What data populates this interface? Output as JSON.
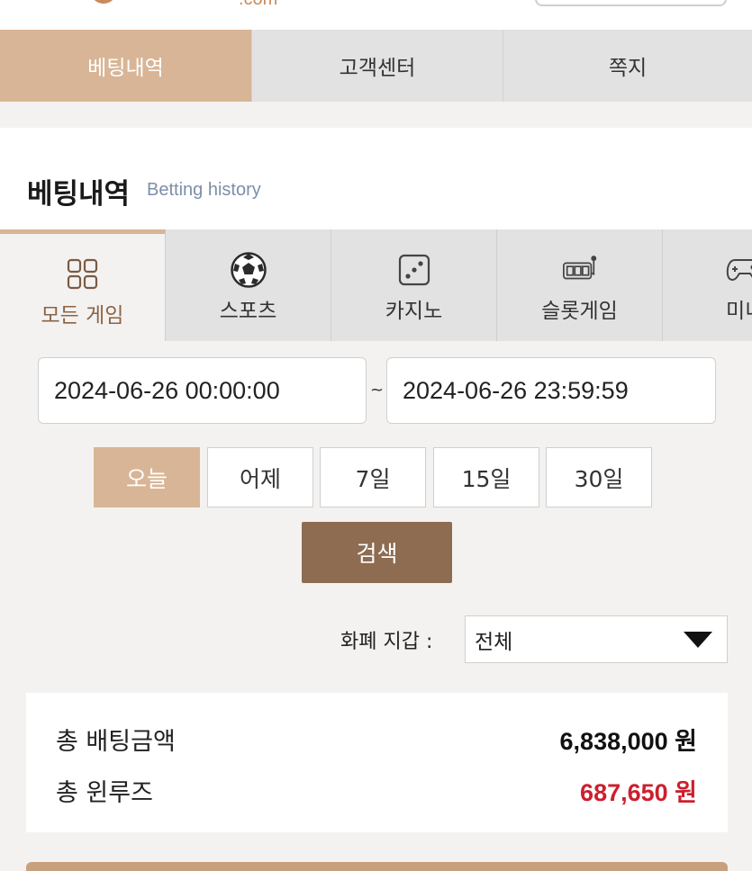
{
  "header": {
    "logo_suffix": ".com"
  },
  "main_nav": [
    "베팅내역",
    "고객센터",
    "쪽지"
  ],
  "page": {
    "title_ko": "베팅내역",
    "title_en": "Betting history"
  },
  "game_tabs": [
    "모든 게임",
    "스포츠",
    "카지노",
    "슬롯게임",
    "미니"
  ],
  "date_range": {
    "from": "2024-06-26 00:00:00",
    "separator": "~",
    "to": "2024-06-26 23:59:59"
  },
  "periods": [
    "오늘",
    "어제",
    "7일",
    "15일",
    "30일"
  ],
  "search_label": "검색",
  "currency": {
    "label": "화폐 지갑 :",
    "selected": "전체"
  },
  "summary": {
    "total_bet_label": "총 배팅금액",
    "total_bet_value": "6,838,000 원",
    "total_winloss_label": "총 윈루즈",
    "total_winloss_value": "687,650 원"
  },
  "colors": {
    "accent": "#d8b596",
    "accent_dark": "#8d6c51",
    "loss_red": "#cc1f2d",
    "tab_gray": "#e2e2e2"
  }
}
